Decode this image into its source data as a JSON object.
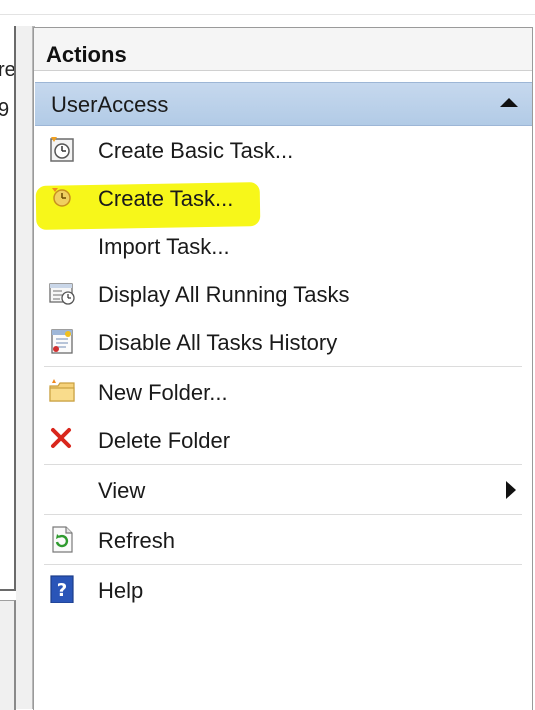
{
  "left_fragments": [
    "re",
    "9"
  ],
  "actions": {
    "title": "Actions",
    "group": "UserAccess",
    "items": [
      {
        "label": "Create Basic Task...",
        "icon": "create-basic-task-icon"
      },
      {
        "label": "Create Task...",
        "icon": "create-task-icon"
      },
      {
        "label": "Import Task...",
        "icon": ""
      },
      {
        "label": "Display All Running Tasks",
        "icon": "running-tasks-icon"
      },
      {
        "label": "Disable All Tasks History",
        "icon": "tasks-history-icon"
      },
      {
        "label": "New Folder...",
        "icon": "new-folder-icon"
      },
      {
        "label": "Delete Folder",
        "icon": "delete-icon"
      },
      {
        "label": "View",
        "icon": ""
      },
      {
        "label": "Refresh",
        "icon": "refresh-icon"
      },
      {
        "label": "Help",
        "icon": "help-icon"
      }
    ]
  },
  "colors": {
    "group_bar": "#b8cfe9",
    "highlight": "#f7f71a",
    "delete_red": "#d9261c",
    "help_blue": "#2a55b8"
  }
}
